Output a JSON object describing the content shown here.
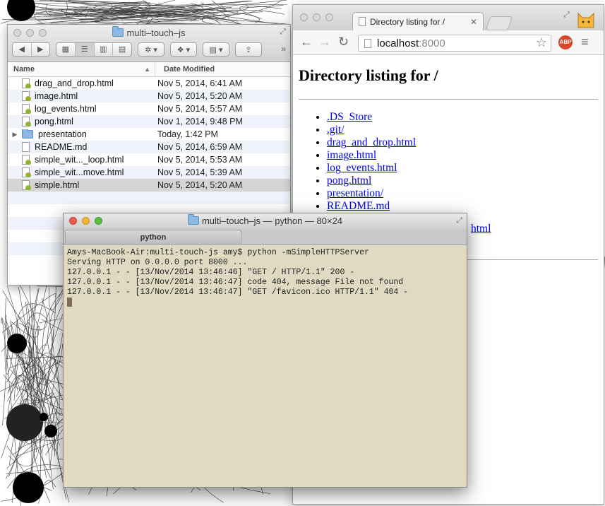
{
  "finder": {
    "title": "multi–touch–js",
    "columns": {
      "name": "Name",
      "date": "Date Modified"
    },
    "rows": [
      {
        "name": "drag_and_drop.html",
        "date": "Nov 5, 2014, 6:41 AM",
        "icon": "html-file-icon"
      },
      {
        "name": "image.html",
        "date": "Nov 5, 2014, 5:20 AM",
        "icon": "html-file-icon"
      },
      {
        "name": "log_events.html",
        "date": "Nov 5, 2014, 5:57 AM",
        "icon": "html-file-icon"
      },
      {
        "name": "pong.html",
        "date": "Nov 1, 2014, 9:48 PM",
        "icon": "html-file-icon"
      },
      {
        "name": "presentation",
        "date": "Today, 1:42 PM",
        "icon": "folder-icon"
      },
      {
        "name": "README.md",
        "date": "Nov 5, 2014, 6:59 AM",
        "icon": "text-file-icon"
      },
      {
        "name": "simple_wit..._loop.html",
        "date": "Nov 5, 2014, 5:53 AM",
        "icon": "html-file-icon"
      },
      {
        "name": "simple_wit...move.html",
        "date": "Nov 5, 2014, 5:39 AM",
        "icon": "html-file-icon"
      },
      {
        "name": "simple.html",
        "date": "Nov 5, 2014, 5:20 AM",
        "icon": "html-file-icon",
        "selected": true
      }
    ]
  },
  "browser": {
    "tab_title": "Directory listing for /",
    "url_host": "localhost",
    "url_port": ":8000",
    "abp_label": "ABP",
    "heading": "Directory listing for /",
    "links": [
      ".DS_Store",
      ".git/",
      "drag_and_drop.html",
      "image.html",
      "log_events.html",
      "pong.html",
      "presentation/",
      "README.md"
    ],
    "partial_link": "html"
  },
  "terminal": {
    "title": "multi–touch–js — python — 80×24",
    "tab_label": "python",
    "lines": [
      "Amys-MacBook-Air:multi-touch-js amy$ python -mSimpleHTTPServer",
      "Serving HTTP on 0.0.0.0 port 8000 ...",
      "127.0.0.1 - - [13/Nov/2014 13:46:46] \"GET / HTTP/1.1\" 200 -",
      "127.0.0.1 - - [13/Nov/2014 13:46:47] code 404, message File not found",
      "127.0.0.1 - - [13/Nov/2014 13:46:47] \"GET /favicon.ico HTTP/1.1\" 404 -"
    ]
  },
  "colors": {
    "terminal_bg": "#dfdac1",
    "link": "#0000ee",
    "selection": "#d4d4d4"
  }
}
